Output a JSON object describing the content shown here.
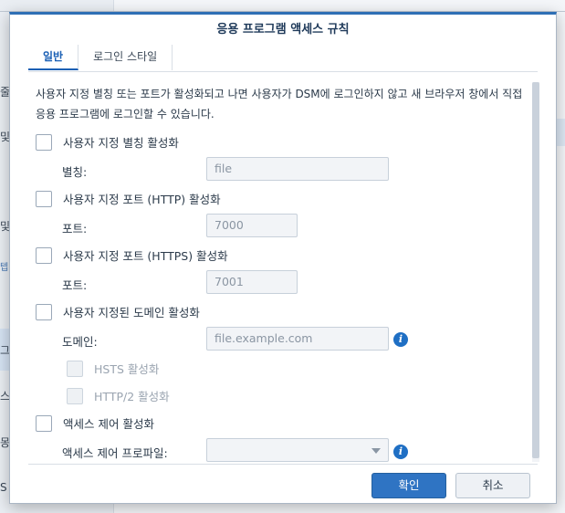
{
  "background": {
    "sidebar_fragments": [
      "줄",
      "및",
      "및",
      "텝",
      "그",
      "스",
      "몽",
      "S"
    ]
  },
  "dialog": {
    "title": "응용 프로그램 액세스 규칙",
    "tabs": [
      {
        "label": "일반",
        "active": true
      },
      {
        "label": "로그인 스타일",
        "active": false
      }
    ],
    "description": "사용자 지정 별칭 또는 포트가 활성화되고 나면 사용자가 DSM에 로그인하지 않고 새 브라우저 창에서 직접 응용 프로그램에 로그인할 수 있습니다.",
    "options": {
      "alias": {
        "checkbox_label": "사용자 지정 별칭 활성화",
        "checked": false,
        "field_label": "별칭:",
        "placeholder": "file"
      },
      "http": {
        "checkbox_label": "사용자 지정 포트 (HTTP) 활성화",
        "checked": false,
        "field_label": "포트:",
        "placeholder": "7000"
      },
      "https": {
        "checkbox_label": "사용자 지정 포트 (HTTPS) 활성화",
        "checked": false,
        "field_label": "포트:",
        "placeholder": "7001"
      },
      "domain": {
        "checkbox_label": "사용자 지정된 도메인 활성화",
        "checked": false,
        "field_label": "도메인:",
        "placeholder": "file.example.com",
        "hsts_label": "HSTS 활성화",
        "http2_label": "HTTP/2 활성화"
      },
      "access_control": {
        "checkbox_label": "액세스 제어 활성화",
        "checked": false,
        "field_label": "액세스 제어 프로파일:",
        "selected_value": ""
      }
    },
    "buttons": {
      "ok": "확인",
      "cancel": "취소"
    },
    "colors": {
      "accent": "#2f74c3",
      "info_icon": "#1f6fc4"
    }
  }
}
